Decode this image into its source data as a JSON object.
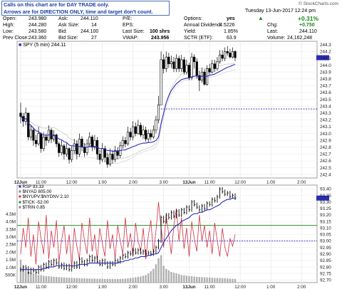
{
  "annotation": {
    "line1": "Calls on this chart are for DAY TRADE only.",
    "line2": "Arrows are for DIRECTION ONLY, time and target don't count."
  },
  "quote": {
    "open_label": "Open:",
    "open": "243.980",
    "high_label": "High:",
    "high": "244.280",
    "low_label": "Low:",
    "low": "243.580",
    "prev_close_label": "Prev Close:",
    "prev_close": "243.360",
    "ask_label": "Ask:",
    "ask": "244.110",
    "ask_size_label": "Ask Size:",
    "ask_size": "14",
    "bid_label": "Bid:",
    "bid": "244.100",
    "bid_size_label": "Bid Size:",
    "bid_size": "27",
    "pe_label": "P/E:",
    "pe": "",
    "eps_label": "EPS:",
    "eps": "",
    "last_size_label": "Last Size:",
    "last_size": "100 shrs",
    "vwap_label": "VWAP:",
    "vwap": "243.956",
    "options_label": "Options:",
    "options": "yes",
    "annual_dividend_label": "Annual Dividend:",
    "annual_dividend": "4.5226",
    "yield_label": "Yield:",
    "yield": "1.85%",
    "sctr_label": "SCTR (ETF):",
    "sctr": "63.9",
    "date": "Tuesday  13-Jun-2017  12:24 pm",
    "chg_pct": "+0.31%",
    "chg_label": "Chg:",
    "chg": "+0.750",
    "last_label": "Last:",
    "last": "244.110",
    "volume_label": "Volume:",
    "volume": "24,162,248",
    "watermark": "© StockCharts.com"
  },
  "colors": {
    "price_up": "#ffffff",
    "price_down": "#000000",
    "vwap_line": "#2b2bb8",
    "sma_line": "#c8c8c8",
    "dotted_line": "#2b2bb8",
    "rsp_line": "#2b2bb8",
    "rsp_bars": "#000000",
    "ratio_line": "#cc3344",
    "volume_bars": "#b0b0b0",
    "hline_green": "#2e8a2e",
    "hline_blue": "#2b2bb8"
  },
  "chart_data": [
    {
      "type": "line",
      "title": "SPY (5 min) 244.11",
      "x_ticks": [
        "12Jun",
        "11:00",
        "12:00",
        "1:00",
        "2:00",
        "3:00",
        "13Jun",
        "11:00",
        "12:00",
        "1:00",
        "2:00",
        "3:00"
      ],
      "y_ticks": [
        242.4,
        242.5,
        242.6,
        242.7,
        242.8,
        242.9,
        243.0,
        243.1,
        243.2,
        243.3,
        243.4,
        243.5,
        243.6,
        243.7,
        243.8,
        243.9,
        244.0,
        244.1,
        244.2,
        244.3
      ],
      "ylim": [
        242.35,
        244.35
      ],
      "reference_line": 243.36,
      "series": [
        {
          "name": "SPY",
          "style": "candlestick",
          "close": [
            243.25,
            243.18,
            243.3,
            242.95,
            243.05,
            242.9,
            242.85,
            243.0,
            242.78,
            242.95,
            242.9,
            243.05,
            242.92,
            242.98,
            242.85,
            242.72,
            242.82,
            242.7,
            242.78,
            242.62,
            242.75,
            242.85,
            242.7,
            242.92,
            242.8,
            242.72,
            242.85,
            242.95,
            242.8,
            242.9,
            242.7,
            242.62,
            242.78,
            242.65,
            242.55,
            242.7,
            242.62,
            242.75,
            242.68,
            242.82,
            242.9,
            242.85,
            243.02,
            242.95,
            243.1,
            243.0,
            243.12,
            242.98,
            243.05,
            242.92,
            243.0,
            242.95,
            243.05,
            243.2,
            243.42,
            244.08,
            243.95,
            244.12,
            244.02,
            244.05,
            243.95,
            244.1,
            243.95,
            244.08,
            243.9,
            244.0,
            243.82,
            244.12,
            244.05,
            243.85,
            243.78,
            243.9,
            243.72,
            243.95,
            243.9,
            244.02,
            243.95,
            244.05,
            244.15,
            244.1,
            244.2,
            244.18,
            244.12,
            244.2,
            244.11
          ],
          "high": [
            243.45,
            243.3,
            243.38,
            243.3,
            243.12,
            243.08,
            242.98,
            243.1,
            243.02,
            243.02,
            243.0,
            243.12,
            243.08,
            243.05,
            243.0,
            242.88,
            242.9,
            242.85,
            242.86,
            242.8,
            242.82,
            242.92,
            242.9,
            243.0,
            242.96,
            242.86,
            242.92,
            243.02,
            242.98,
            242.98,
            242.95,
            242.76,
            242.86,
            242.82,
            242.72,
            242.78,
            242.76,
            242.82,
            242.8,
            242.88,
            242.96,
            242.95,
            243.1,
            243.08,
            243.18,
            243.16,
            243.2,
            243.16,
            243.12,
            243.1,
            243.06,
            243.06,
            243.12,
            243.26,
            243.55,
            244.2,
            244.16,
            244.2,
            244.18,
            244.14,
            244.12,
            244.16,
            244.14,
            244.15,
            244.12,
            244.08,
            244.04,
            244.18,
            244.16,
            244.1,
            243.92,
            243.96,
            243.94,
            244.0,
            244.02,
            244.08,
            244.08,
            244.12,
            244.22,
            244.22,
            244.26,
            244.28,
            244.24,
            244.26,
            244.22
          ],
          "low": [
            243.15,
            243.1,
            243.12,
            242.9,
            242.9,
            242.82,
            242.8,
            242.82,
            242.72,
            242.74,
            242.82,
            242.86,
            242.86,
            242.88,
            242.8,
            242.66,
            242.68,
            242.62,
            242.66,
            242.56,
            242.58,
            242.7,
            242.62,
            242.66,
            242.74,
            242.66,
            242.68,
            242.8,
            242.74,
            242.76,
            242.62,
            242.55,
            242.58,
            242.58,
            242.5,
            242.52,
            242.56,
            242.58,
            242.62,
            242.64,
            242.78,
            242.8,
            242.82,
            242.9,
            242.9,
            242.96,
            242.98,
            242.95,
            242.92,
            242.88,
            242.86,
            242.9,
            242.92,
            243.0,
            243.15,
            243.85,
            243.88,
            243.9,
            243.96,
            243.96,
            243.9,
            243.9,
            243.9,
            243.9,
            243.86,
            243.86,
            243.78,
            243.78,
            243.96,
            243.8,
            243.62,
            243.74,
            243.7,
            243.7,
            243.86,
            243.88,
            243.9,
            243.92,
            244.02,
            244.06,
            244.06,
            244.14,
            244.1,
            244.1,
            244.06
          ]
        },
        {
          "name": "VWAP",
          "style": "line",
          "values": [
            243.25,
            243.21,
            243.22,
            243.15,
            243.12,
            243.08,
            243.04,
            243.03,
            242.99,
            242.98,
            242.97,
            242.98,
            242.97,
            242.97,
            242.95,
            242.92,
            242.91,
            242.88,
            242.87,
            242.83,
            242.82,
            242.82,
            242.8,
            242.81,
            242.81,
            242.8,
            242.8,
            242.81,
            242.81,
            242.81,
            242.8,
            242.78,
            242.78,
            242.77,
            242.75,
            242.75,
            242.74,
            242.74,
            242.74,
            242.75,
            242.76,
            242.76,
            242.78,
            242.79,
            242.81,
            242.82,
            242.84,
            242.85,
            242.86,
            242.86,
            242.87,
            242.87,
            242.88,
            242.9,
            242.95,
            243.15,
            243.3,
            243.45,
            243.55,
            243.63,
            243.68,
            243.73,
            243.76,
            243.79,
            243.8,
            243.81,
            243.81,
            243.83,
            243.84,
            243.84,
            243.83,
            243.84,
            243.83,
            243.84,
            243.85,
            243.86,
            243.87,
            243.89,
            243.91,
            243.93,
            243.95,
            243.97,
            243.98,
            244.0,
            244.01
          ]
        }
      ]
    },
    {
      "type": "line",
      "legend": [
        "RSP 93.33",
        "$NYAD 805.00",
        "$NYUPV:$NYDNV 2.10",
        "$TICK -52.00",
        "$TRIN 0.85"
      ],
      "x_ticks": [
        "12Jun",
        "11:00",
        "12:00",
        "1:00",
        "2:00",
        "3:00",
        "13Jun",
        "11:00",
        "12:00",
        "1:00",
        "2:00",
        "3:00"
      ],
      "y_ticks": [
        92.7,
        92.75,
        92.8,
        92.85,
        92.9,
        92.95,
        93.0,
        93.05,
        93.1,
        93.15,
        93.2,
        93.25,
        93.3,
        93.35,
        93.4
      ],
      "ylim": [
        92.68,
        93.43
      ],
      "volume_ticks": [
        "500K",
        "1.0M",
        "1.5M",
        "2.0M",
        "2.5M",
        "3.0M",
        "3.5M",
        "4.0M",
        "4.5M"
      ],
      "volume_ylim": [
        0,
        5000000
      ],
      "reference_lines": [
        93.12,
        93.0
      ],
      "series": [
        {
          "name": "RSP",
          "style": "bars",
          "close": [
            92.78,
            92.8,
            92.79,
            92.76,
            92.78,
            92.77,
            92.76,
            92.8,
            92.78,
            92.82,
            92.8,
            92.84,
            92.82,
            92.85,
            92.83,
            92.8,
            92.82,
            92.79,
            92.81,
            92.78,
            92.8,
            92.83,
            92.8,
            92.86,
            92.84,
            92.82,
            92.85,
            92.88,
            92.85,
            92.87,
            92.84,
            92.82,
            92.85,
            92.83,
            92.8,
            92.83,
            92.82,
            92.85,
            92.84,
            92.87,
            92.89,
            92.88,
            92.91,
            92.9,
            92.93,
            92.91,
            92.93,
            92.91,
            92.92,
            92.9,
            92.91,
            92.9,
            92.92,
            92.95,
            93.0,
            93.18,
            93.15,
            93.2,
            93.18,
            93.22,
            93.19,
            93.23,
            93.2,
            93.24,
            93.22,
            93.26,
            93.24,
            93.3,
            93.28,
            93.26,
            93.24,
            93.27,
            93.25,
            93.29,
            93.28,
            93.32,
            93.31,
            93.34,
            93.4,
            93.38,
            93.36,
            93.37,
            93.34,
            93.35,
            93.33
          ]
        },
        {
          "name": "RSP trend",
          "style": "line",
          "values": [
            92.78,
            92.78,
            92.78,
            92.78,
            92.78,
            92.78,
            92.78,
            92.78,
            92.78,
            92.79,
            92.79,
            92.8,
            92.8,
            92.8,
            92.81,
            92.81,
            92.81,
            92.81,
            92.81,
            92.81,
            92.81,
            92.81,
            92.81,
            92.82,
            92.82,
            92.82,
            92.82,
            92.83,
            92.83,
            92.83,
            92.83,
            92.83,
            92.83,
            92.83,
            92.83,
            92.83,
            92.83,
            92.83,
            92.83,
            92.84,
            92.84,
            92.85,
            92.85,
            92.86,
            92.86,
            92.87,
            92.87,
            92.88,
            92.88,
            92.88,
            92.89,
            92.89,
            92.9,
            92.9,
            92.91,
            92.95,
            92.99,
            93.02,
            93.05,
            93.08,
            93.1,
            93.12,
            93.13,
            93.15,
            93.16,
            93.17,
            93.18,
            93.2,
            93.21,
            93.21,
            93.22,
            93.22,
            93.23,
            93.24,
            93.24,
            93.25,
            93.26,
            93.27,
            93.28,
            93.3,
            93.31,
            93.32,
            93.32,
            93.33,
            93.33
          ]
        },
        {
          "name": "Volume",
          "style": "bars",
          "values": [
            1500000,
            950000,
            800000,
            700000,
            650000,
            600000,
            550000,
            500000,
            480000,
            450000,
            430000,
            420000,
            400000,
            380000,
            370000,
            360000,
            350000,
            340000,
            330000,
            320000,
            310000,
            300000,
            300000,
            290000,
            280000,
            280000,
            270000,
            270000,
            260000,
            260000,
            250000,
            250000,
            250000,
            240000,
            240000,
            240000,
            230000,
            230000,
            230000,
            240000,
            250000,
            260000,
            280000,
            300000,
            320000,
            350000,
            380000,
            400000,
            450000,
            500000,
            600000,
            750000,
            900000,
            1200000,
            1600000,
            1800000,
            1100000,
            900000,
            800000,
            700000,
            650000,
            600000,
            550000,
            500000,
            480000,
            450000,
            430000,
            420000,
            400000,
            380000,
            370000,
            360000,
            350000,
            340000,
            330000,
            320000,
            310000,
            300000,
            300000,
            290000,
            280000,
            270000,
            260000,
            250000,
            240000
          ]
        },
        {
          "name": "Ratio",
          "style": "line",
          "values": [
            92.9,
            93.1,
            92.95,
            93.18,
            92.88,
            93.05,
            92.82,
            93.15,
            93.02,
            92.9,
            93.2,
            92.86,
            93.08,
            92.95,
            93.16,
            92.84,
            93.0,
            93.12,
            92.9,
            93.05,
            92.8,
            93.1,
            92.96,
            92.86,
            93.14,
            93.0,
            92.9,
            93.18,
            92.92,
            93.05,
            92.85,
            93.1,
            92.98,
            92.88,
            93.16,
            92.94,
            93.05,
            92.86,
            93.12,
            93.0,
            92.9,
            93.18,
            92.95,
            93.06,
            92.88,
            93.14,
            93.0,
            92.92,
            93.1,
            92.86,
            93.04,
            93.16,
            92.9,
            93.08,
            93.3,
            93.1,
            92.95,
            93.2,
            93.05,
            92.9,
            93.12,
            93.25,
            93.0,
            93.18,
            92.94,
            93.1,
            92.88,
            93.15,
            93.02,
            92.92,
            93.2,
            93.0,
            93.12,
            92.95,
            93.08,
            92.9,
            93.14,
            93.0,
            92.88,
            93.1,
            92.95,
            92.88,
            93.02,
            92.96,
            93.05
          ]
        }
      ]
    }
  ]
}
